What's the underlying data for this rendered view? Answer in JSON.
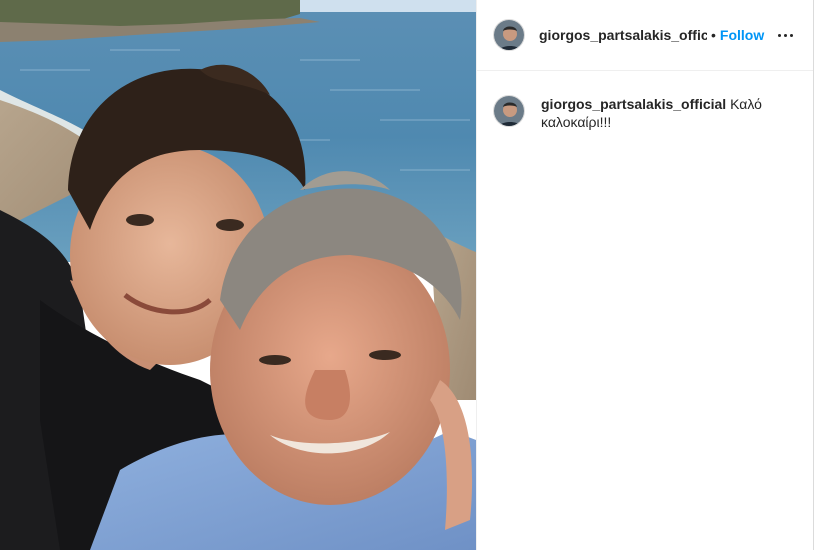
{
  "post": {
    "username": "giorgos_partsalakis_officia",
    "separator": "•",
    "follow_label": "Follow",
    "more_icon": "more-horizontal-icon",
    "caption": {
      "username": "giorgos_partsalakis_official",
      "text": "Καλό καλοκαίρι!!!"
    }
  },
  "colors": {
    "follow": "#0095f6",
    "text": "#262626",
    "border": "#dbdbdb"
  }
}
